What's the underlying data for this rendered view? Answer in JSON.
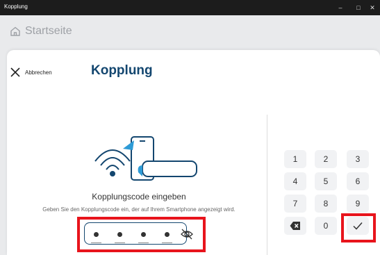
{
  "window": {
    "title": "Kopplung",
    "minimize": "–",
    "maximize": "□",
    "close": "✕"
  },
  "app": {
    "home_label": "Startseite"
  },
  "dialog": {
    "cancel_label": "Abbrechen",
    "title": "Kopplung",
    "code_title": "Kopplungscode eingeben",
    "code_hint": "Geben Sie den Kopplungscode ein, der auf Ihrem Smartphone angezeigt wird."
  },
  "keypad": {
    "k1": "1",
    "k2": "2",
    "k3": "3",
    "k4": "4",
    "k5": "5",
    "k6": "6",
    "k7": "7",
    "k8": "8",
    "k9": "9",
    "k0": "0"
  },
  "colors": {
    "accent": "#13466f",
    "highlight": "#e8141c"
  }
}
